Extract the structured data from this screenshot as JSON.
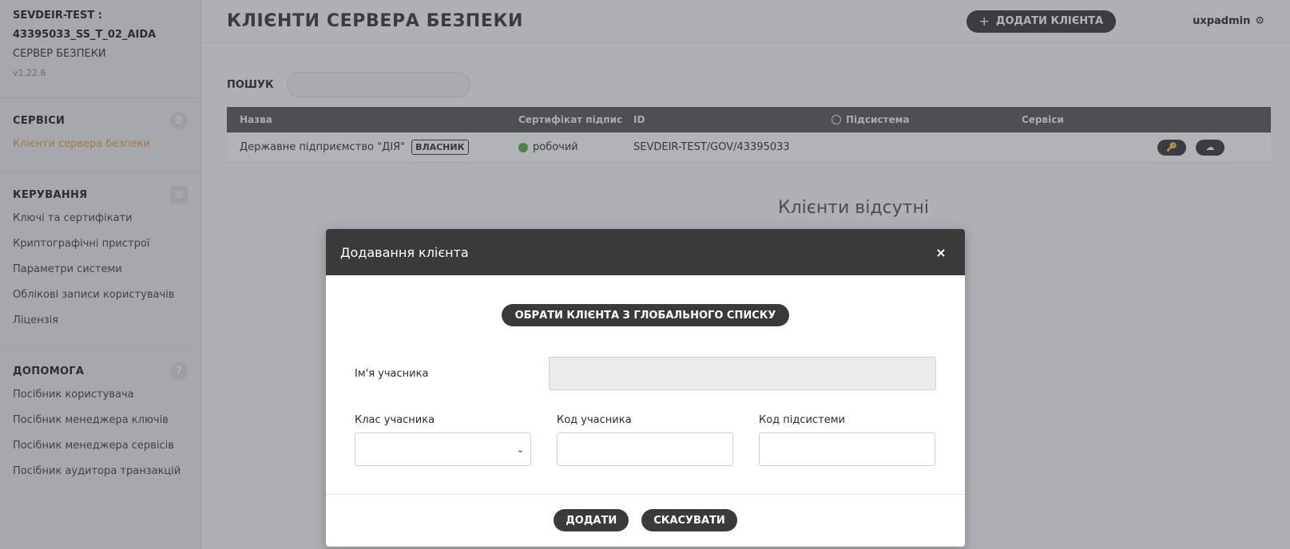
{
  "sidebar": {
    "server_name": "SEVDEIR-TEST : 43395033_SS_T_02_AIDA",
    "server_type": "СЕРВЕР БЕЗПЕКИ",
    "version": "v1.22.6",
    "sections": [
      {
        "title": "СЕРВІСИ",
        "icon": "gear-icon",
        "items": [
          "Клієнти сервера безпеки"
        ]
      },
      {
        "title": "КЕРУВАННЯ",
        "icon": "server-icon",
        "items": [
          "Ключі та сертифікати",
          "Криптографічні пристрої",
          "Параметри системи",
          "Облікові записи користувачів",
          "Ліцензія"
        ]
      },
      {
        "title": "ДОПОМОГА",
        "icon": "help-icon",
        "items": [
          "Посібник користувача",
          "Посібник менеджера ключів",
          "Посібник менеджера сервісів",
          "Посібник аудитора транзакцій"
        ]
      }
    ]
  },
  "header": {
    "title": "КЛІЄНТИ СЕРВЕРА БЕЗПЕКИ",
    "add_client_label": "ДОДАТИ КЛІЄНТА",
    "username": "uxpadmin"
  },
  "search": {
    "label": "ПОШУК",
    "value": ""
  },
  "table": {
    "columns": [
      "Назва",
      "Сертифікат підпис",
      "ID",
      "Підсистема",
      "Сервіси"
    ],
    "rows": [
      {
        "name": "Державне підприємство \"ДІЯ\"",
        "badge": "ВЛАСНИК",
        "cert_status": "робочий",
        "id": "SEVDEIR-TEST/GOV/43395033"
      }
    ]
  },
  "empty_message": "Клієнти відсутні",
  "modal": {
    "title": "Додавання клієнта",
    "close_glyph": "×",
    "global_list_label": "ОБРАТИ КЛІЄНТА З ГЛОБАЛЬНОГО СПИСКУ",
    "member_name_label": "Ім'я учасника",
    "member_class_label": "Клас учасника",
    "member_code_label": "Код учасника",
    "subsystem_code_label": "Код підсистеми",
    "add_label": "ДОДАТИ",
    "cancel_label": "СКАСУВАТИ"
  },
  "colors": {
    "accent": "#e6a23c",
    "dark": "#3a3a3a",
    "status_ok": "#57b33e"
  }
}
